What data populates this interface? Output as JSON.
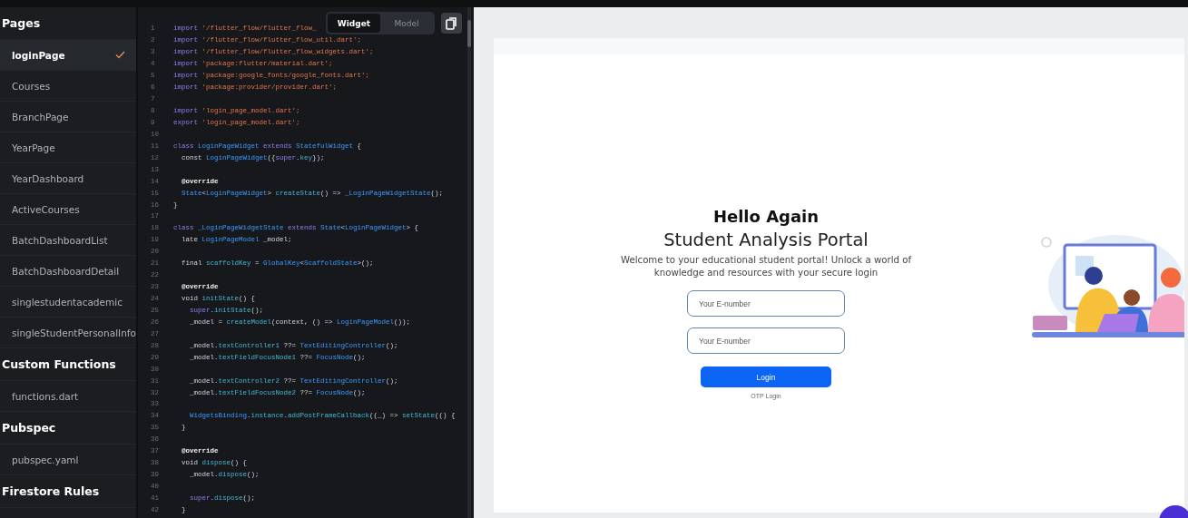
{
  "sidebar": {
    "sections": [
      {
        "title": "Pages",
        "items": [
          {
            "label": "loginPage",
            "selected": true
          },
          {
            "label": "Courses",
            "selected": false
          },
          {
            "label": "BranchPage",
            "selected": false
          },
          {
            "label": "YearPage",
            "selected": false
          },
          {
            "label": "YearDashboard",
            "selected": false
          },
          {
            "label": "ActiveCourses",
            "selected": false
          },
          {
            "label": "BatchDashboardList",
            "selected": false
          },
          {
            "label": "BatchDashboardDetail",
            "selected": false
          },
          {
            "label": "singlestudentacademic",
            "selected": false
          },
          {
            "label": "singleStudentPersonalInfo",
            "selected": false
          }
        ]
      },
      {
        "title": "Custom Functions",
        "items": [
          {
            "label": "functions.dart",
            "selected": false
          }
        ]
      },
      {
        "title": "Pubspec",
        "items": [
          {
            "label": "pubspec.yaml",
            "selected": false
          }
        ]
      },
      {
        "title": "Firestore Rules"
      }
    ]
  },
  "code_view": {
    "tabs": [
      {
        "label": "Widget",
        "selected": true
      },
      {
        "label": "Model",
        "selected": false
      }
    ],
    "lines": [
      {
        "number": "1",
        "segments": [
          {
            "kind": "kw",
            "text": "import "
          },
          {
            "kind": "str",
            "text": "'/flutter_flow/flutter_flow_"
          }
        ]
      },
      {
        "number": "2",
        "segments": [
          {
            "kind": "kw",
            "text": "import "
          },
          {
            "kind": "str",
            "text": "'/flutter_flow/flutter_flow_util.dart';"
          }
        ]
      },
      {
        "number": "3",
        "segments": [
          {
            "kind": "kw",
            "text": "import "
          },
          {
            "kind": "str",
            "text": "'/flutter_flow/flutter_flow_widgets.dart';"
          }
        ]
      },
      {
        "number": "4",
        "segments": [
          {
            "kind": "kw",
            "text": "import "
          },
          {
            "kind": "str",
            "text": "'package:flutter/material.dart';"
          }
        ]
      },
      {
        "number": "5",
        "segments": [
          {
            "kind": "kw",
            "text": "import "
          },
          {
            "kind": "str",
            "text": "'package:google_fonts/google_fonts.dart';"
          }
        ]
      },
      {
        "number": "6",
        "segments": [
          {
            "kind": "kw",
            "text": "import "
          },
          {
            "kind": "str",
            "text": "'package:provider/provider.dart';"
          }
        ]
      },
      {
        "number": "7"
      },
      {
        "number": "8",
        "segments": [
          {
            "kind": "kw",
            "text": "import "
          },
          {
            "kind": "str",
            "text": "'login_page_model.dart';"
          }
        ]
      },
      {
        "number": "9",
        "segments": [
          {
            "kind": "kw",
            "text": "export "
          },
          {
            "kind": "str",
            "text": "'login_page_model.dart';"
          }
        ]
      },
      {
        "number": "10"
      },
      {
        "number": "11",
        "segments": [
          {
            "kind": "kw",
            "text": "class "
          },
          {
            "kind": "type",
            "text": "LoginPageWidget "
          },
          {
            "kind": "kw",
            "text": "extends "
          },
          {
            "kind": "type",
            "text": "StatefulWidget "
          },
          {
            "kind": "plain",
            "text": "{"
          }
        ]
      },
      {
        "number": "12",
        "segments": [
          {
            "kind": "plain",
            "text": "  const "
          },
          {
            "kind": "type",
            "text": "LoginPageWidget"
          },
          {
            "kind": "plain",
            "text": "({"
          },
          {
            "kind": "kw",
            "text": "super"
          },
          {
            "kind": "plain",
            "text": "."
          },
          {
            "kind": "fn",
            "text": "key"
          },
          {
            "kind": "plain",
            "text": "});"
          }
        ]
      },
      {
        "number": "13"
      },
      {
        "number": "14",
        "segments": [
          {
            "kind": "anno",
            "text": "  @override"
          }
        ]
      },
      {
        "number": "15",
        "segments": [
          {
            "kind": "type",
            "text": "  State"
          },
          {
            "kind": "plain",
            "text": "<"
          },
          {
            "kind": "type",
            "text": "LoginPageWidget"
          },
          {
            "kind": "plain",
            "text": "> "
          },
          {
            "kind": "fn",
            "text": "createState"
          },
          {
            "kind": "plain",
            "text": "() => "
          },
          {
            "kind": "type",
            "text": "_LoginPageWidgetState"
          },
          {
            "kind": "plain",
            "text": "();"
          }
        ]
      },
      {
        "number": "16",
        "segments": [
          {
            "kind": "plain",
            "text": "}"
          }
        ]
      },
      {
        "number": "17"
      },
      {
        "number": "18",
        "segments": [
          {
            "kind": "kw",
            "text": "class "
          },
          {
            "kind": "type",
            "text": "_LoginPageWidgetState "
          },
          {
            "kind": "kw",
            "text": "extends "
          },
          {
            "kind": "type",
            "text": "State"
          },
          {
            "kind": "plain",
            "text": "<"
          },
          {
            "kind": "type",
            "text": "LoginPageWidget"
          },
          {
            "kind": "plain",
            "text": "> {"
          }
        ]
      },
      {
        "number": "19",
        "segments": [
          {
            "kind": "plain",
            "text": "  late "
          },
          {
            "kind": "type",
            "text": "LoginPageModel "
          },
          {
            "kind": "plain",
            "text": "_model;"
          }
        ]
      },
      {
        "number": "20"
      },
      {
        "number": "21",
        "segments": [
          {
            "kind": "plain",
            "text": "  final "
          },
          {
            "kind": "fn",
            "text": "scaffoldKey"
          },
          {
            "kind": "plain",
            "text": " = "
          },
          {
            "kind": "type",
            "text": "GlobalKey"
          },
          {
            "kind": "plain",
            "text": "<"
          },
          {
            "kind": "type",
            "text": "ScaffoldState"
          },
          {
            "kind": "plain",
            "text": ">();"
          }
        ]
      },
      {
        "number": "22"
      },
      {
        "number": "23",
        "segments": [
          {
            "kind": "anno",
            "text": "  @override"
          }
        ]
      },
      {
        "number": "24",
        "segments": [
          {
            "kind": "plain",
            "text": "  void "
          },
          {
            "kind": "fn",
            "text": "initState"
          },
          {
            "kind": "plain",
            "text": "() {"
          }
        ]
      },
      {
        "number": "25",
        "segments": [
          {
            "kind": "kw",
            "text": "    super"
          },
          {
            "kind": "plain",
            "text": "."
          },
          {
            "kind": "fn",
            "text": "initState"
          },
          {
            "kind": "plain",
            "text": "();"
          }
        ]
      },
      {
        "number": "26",
        "segments": [
          {
            "kind": "plain",
            "text": "    _model = "
          },
          {
            "kind": "fn",
            "text": "createModel"
          },
          {
            "kind": "plain",
            "text": "(context, () => "
          },
          {
            "kind": "type",
            "text": "LoginPageModel"
          },
          {
            "kind": "plain",
            "text": "());"
          }
        ]
      },
      {
        "number": "27"
      },
      {
        "number": "28",
        "segments": [
          {
            "kind": "plain",
            "text": "    _model."
          },
          {
            "kind": "fn",
            "text": "textController1"
          },
          {
            "kind": "plain",
            "text": " ??= "
          },
          {
            "kind": "type",
            "text": "TextEditingController"
          },
          {
            "kind": "plain",
            "text": "();"
          }
        ]
      },
      {
        "number": "29",
        "segments": [
          {
            "kind": "plain",
            "text": "    _model."
          },
          {
            "kind": "fn",
            "text": "textFieldFocusNode1"
          },
          {
            "kind": "plain",
            "text": " ??= "
          },
          {
            "kind": "type",
            "text": "FocusNode"
          },
          {
            "kind": "plain",
            "text": "();"
          }
        ]
      },
      {
        "number": "30"
      },
      {
        "number": "31",
        "segments": [
          {
            "kind": "plain",
            "text": "    _model."
          },
          {
            "kind": "fn",
            "text": "textController2"
          },
          {
            "kind": "plain",
            "text": " ??= "
          },
          {
            "kind": "type",
            "text": "TextEditingController"
          },
          {
            "kind": "plain",
            "text": "();"
          }
        ]
      },
      {
        "number": "32",
        "segments": [
          {
            "kind": "plain",
            "text": "    _model."
          },
          {
            "kind": "fn",
            "text": "textFieldFocusNode2"
          },
          {
            "kind": "plain",
            "text": " ??= "
          },
          {
            "kind": "type",
            "text": "FocusNode"
          },
          {
            "kind": "plain",
            "text": "();"
          }
        ]
      },
      {
        "number": "33"
      },
      {
        "number": "34",
        "segments": [
          {
            "kind": "type",
            "text": "    WidgetsBinding"
          },
          {
            "kind": "plain",
            "text": "."
          },
          {
            "kind": "fn",
            "text": "instance"
          },
          {
            "kind": "plain",
            "text": "."
          },
          {
            "kind": "fn",
            "text": "addPostFrameCallback"
          },
          {
            "kind": "plain",
            "text": "((_) => "
          },
          {
            "kind": "fn",
            "text": "setState"
          },
          {
            "kind": "plain",
            "text": "(() {"
          }
        ]
      },
      {
        "number": "35",
        "segments": [
          {
            "kind": "plain",
            "text": "  }"
          }
        ]
      },
      {
        "number": "36"
      },
      {
        "number": "37",
        "segments": [
          {
            "kind": "anno",
            "text": "  @override"
          }
        ]
      },
      {
        "number": "38",
        "segments": [
          {
            "kind": "plain",
            "text": "  void "
          },
          {
            "kind": "fn",
            "text": "dispose"
          },
          {
            "kind": "plain",
            "text": "() {"
          }
        ]
      },
      {
        "number": "39",
        "segments": [
          {
            "kind": "plain",
            "text": "    _model."
          },
          {
            "kind": "fn",
            "text": "dispose"
          },
          {
            "kind": "plain",
            "text": "();"
          }
        ]
      },
      {
        "number": "40"
      },
      {
        "number": "41",
        "segments": [
          {
            "kind": "kw",
            "text": "    super"
          },
          {
            "kind": "plain",
            "text": "."
          },
          {
            "kind": "fn",
            "text": "dispose"
          },
          {
            "kind": "plain",
            "text": "();"
          }
        ]
      },
      {
        "number": "42",
        "segments": [
          {
            "kind": "plain",
            "text": "  }"
          }
        ]
      }
    ]
  },
  "preview": {
    "greeting": "Hello Again",
    "title": "Student Analysis Portal",
    "welcome": "Welcome to your educational student portal! Unlock a world of knowledge and resources with your secure login",
    "fields": [
      {
        "placeholder": "Your E-number"
      },
      {
        "placeholder": "Your E-number"
      }
    ],
    "login_button": "Login",
    "otp_link": "OTP Login"
  }
}
